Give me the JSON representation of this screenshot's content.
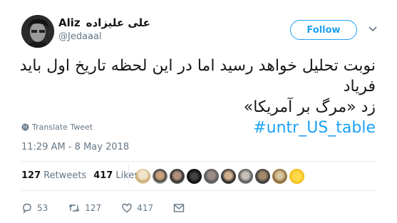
{
  "user": {
    "name_latin": "Aliz",
    "name_persian": "علی علیزاده",
    "handle": "@Jedaaal"
  },
  "follow_label": "Follow",
  "tweet": {
    "text_line1": "نوبت تحلیل خواهد رسید اما در این لحظه تاریخ اول باید فریاد",
    "text_line2": "زد «مرگ بر آمریکا»",
    "hashtag": "#untr_US_table"
  },
  "translate_label": "Translate Tweet",
  "timestamp": "11:29 AM - 8 May 2018",
  "stats": {
    "retweets_count": "127",
    "retweets_label": "Retweets",
    "likes_count": "417",
    "likes_label": "Likes"
  },
  "actions": {
    "reply_count": "53",
    "retweet_count": "127",
    "like_count": "417"
  },
  "colors": {
    "accent": "#1da1f2",
    "muted": "#657786",
    "divider": "#e6ecf0"
  }
}
